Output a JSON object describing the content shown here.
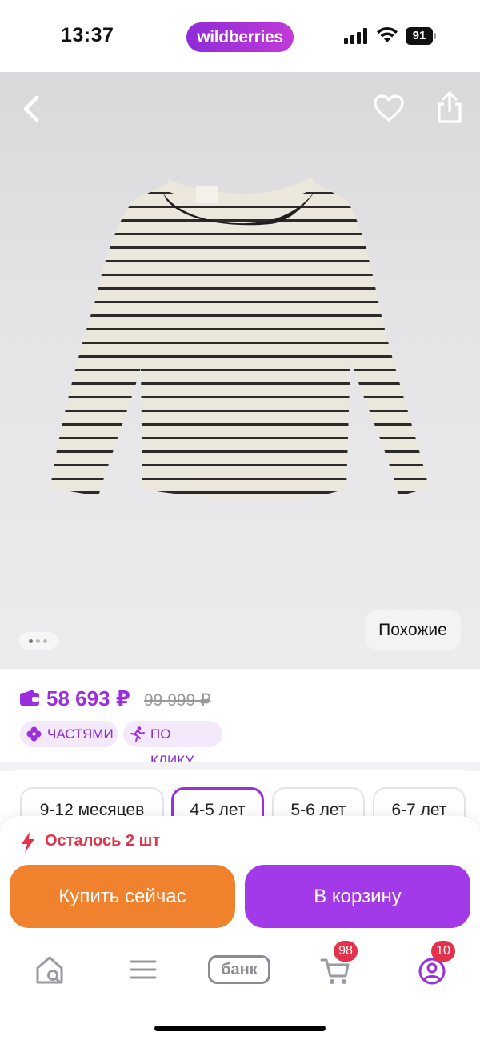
{
  "status_bar": {
    "time": "13:37",
    "battery": "91"
  },
  "brand": {
    "name": "wildberries",
    "accent": "#9b2fe0"
  },
  "product": {
    "image_alt": "striped long-sleeve top",
    "similar_label": "Похожие",
    "price": "58 693 ₽",
    "old_price": "99 999 ₽",
    "chips": [
      "ЧАСТЯМИ",
      "ПО КЛИКУ"
    ]
  },
  "sizes": {
    "options": [
      "9-12 месяцев",
      "4-5 лет",
      "5-6 лет",
      "6-7 лет"
    ],
    "selected": "4-5 лет"
  },
  "stock": {
    "text": "Осталось 2 шт",
    "color": "#e3324b"
  },
  "actions": {
    "buy_now": "Купить сейчас",
    "add_to_cart": "В корзину",
    "buy_color": "#f0812d",
    "cart_color": "#a33aea"
  },
  "tab_bar": {
    "items": [
      "home-search-icon",
      "menu-icon",
      "bank",
      "cart-icon",
      "profile-icon"
    ],
    "bank_label": "банк",
    "cart_badge": "98",
    "profile_badge": "10"
  }
}
